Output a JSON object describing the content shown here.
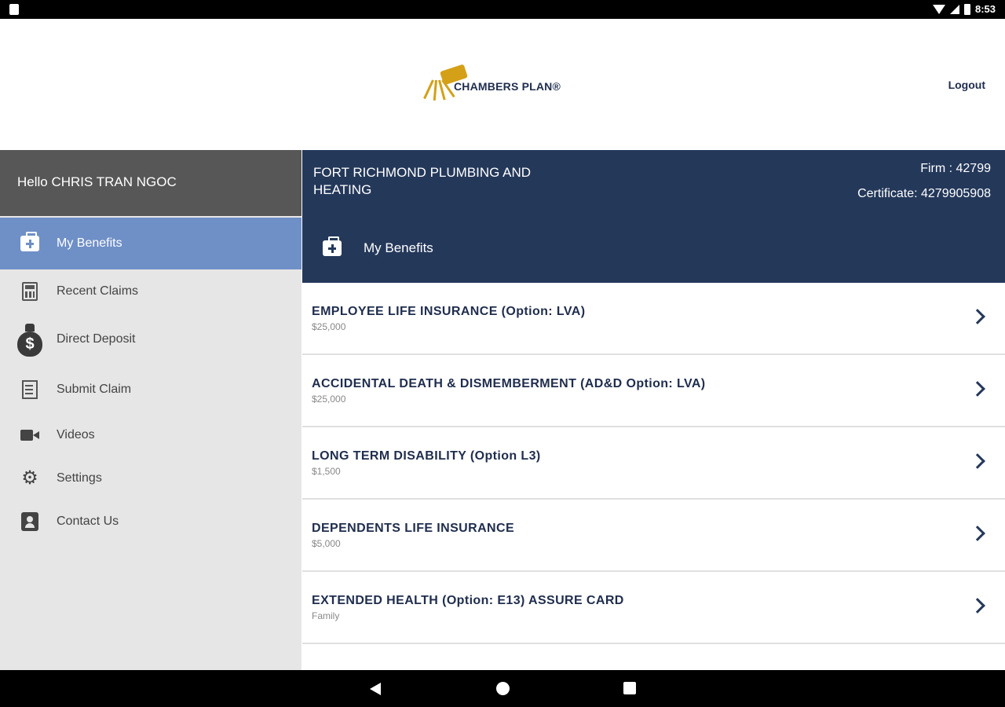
{
  "status_bar": {
    "time": "8:53"
  },
  "header": {
    "logo_text": "CHAMBERS PLAN®",
    "logout_label": "Logout"
  },
  "sidebar": {
    "greeting": "Hello CHRIS TRAN NGOC",
    "items": [
      {
        "label": "My Benefits",
        "icon": "medkit-icon",
        "active": true
      },
      {
        "label": "Recent Claims",
        "icon": "calculator-icon"
      },
      {
        "label": "Direct Deposit",
        "icon": "money-bag-icon"
      },
      {
        "label": "Submit Claim",
        "icon": "document-icon"
      },
      {
        "label": "Videos",
        "icon": "video-camera-icon"
      },
      {
        "label": "Settings",
        "icon": "gear-icon"
      },
      {
        "label": "Contact Us",
        "icon": "contact-card-icon"
      }
    ]
  },
  "main": {
    "firm_name": "FORT RICHMOND PLUMBING AND HEATING",
    "firm": "Firm : 42799",
    "certificate": "Certificate: 4279905908",
    "section_title": "My Benefits",
    "benefits": [
      {
        "title": "EMPLOYEE LIFE INSURANCE (Option: LVA)",
        "value": "$25,000"
      },
      {
        "title": "ACCIDENTAL DEATH & DISMEMBERMENT (AD&D Option: LVA)",
        "value": "$25,000"
      },
      {
        "title": "LONG TERM DISABILITY (Option L3)",
        "value": "$1,500"
      },
      {
        "title": "DEPENDENTS LIFE INSURANCE",
        "value": "$5,000"
      },
      {
        "title": "EXTENDED HEALTH (Option: E13) ASSURE CARD",
        "value": "Family"
      }
    ]
  },
  "colors": {
    "sidebar_active": "#6f8fc7",
    "header_blue": "#24385a",
    "brand_gold": "#d4a017",
    "greeting_bg": "#575757"
  }
}
